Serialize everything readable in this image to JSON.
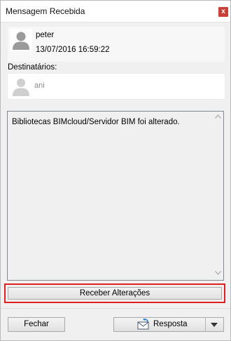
{
  "window": {
    "title": "Mensagem Recebida",
    "close_glyph": "x"
  },
  "sender": {
    "name": "peter",
    "date": "13/07/2016 16:59:22",
    "avatar_icon": "user-silhouette-icon"
  },
  "recipients": {
    "label": "Destinatários:",
    "items": [
      {
        "name": "ani",
        "avatar_icon": "user-silhouette-icon"
      }
    ]
  },
  "message": {
    "text": "Bibliotecas BIMcloud/Servidor BIM foi alterado."
  },
  "buttons": {
    "receive": "Receber Alterações",
    "close": "Fechar",
    "reply": "Resposta"
  },
  "colors": {
    "highlight": "#e02020",
    "close_button": "#c94038"
  }
}
